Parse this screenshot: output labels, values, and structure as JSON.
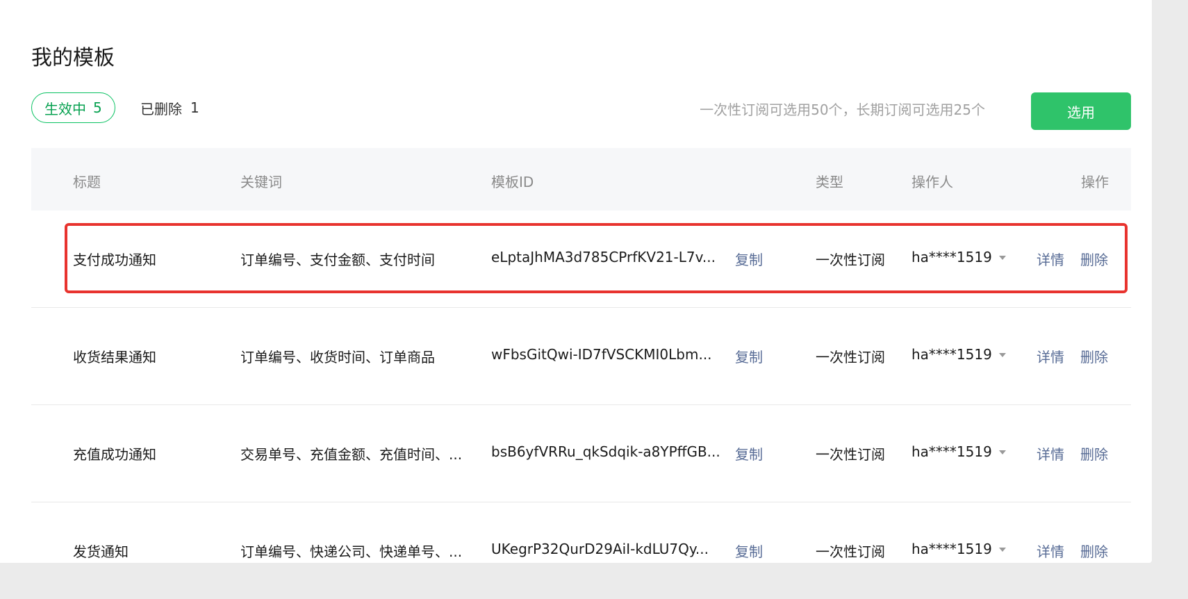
{
  "page": {
    "title": "我的模板"
  },
  "tabs": {
    "active": {
      "label": "生效中",
      "count": "5"
    },
    "deleted": {
      "label": "已删除",
      "count": "1"
    }
  },
  "quota_note": "一次性订阅可选用50个，长期订阅可选用25个",
  "select_button": "选用",
  "table": {
    "headers": {
      "title": "标题",
      "keywords": "关键词",
      "template_id": "模板ID",
      "type": "类型",
      "operator": "操作人",
      "actions": "操作"
    },
    "rows": [
      {
        "title": "支付成功通知",
        "keywords": "订单编号、支付金额、支付时间",
        "template_id": "eLptaJhMA3d785CPrfKV21-L7v...",
        "copy": "复制",
        "type": "一次性订阅",
        "operator": "ha****1519",
        "detail": "详情",
        "delete": "删除"
      },
      {
        "title": "收货结果通知",
        "keywords": "订单编号、收货时间、订单商品",
        "template_id": "wFbsGitQwi-ID7fVSCKMI0Lbm...",
        "copy": "复制",
        "type": "一次性订阅",
        "operator": "ha****1519",
        "detail": "详情",
        "delete": "删除"
      },
      {
        "title": "充值成功通知",
        "keywords": "交易单号、充值金额、充值时间、...",
        "template_id": "bsB6yfVRRu_qkSdqik-a8YPffGB...",
        "copy": "复制",
        "type": "一次性订阅",
        "operator": "ha****1519",
        "detail": "详情",
        "delete": "删除"
      },
      {
        "title": "发货通知",
        "keywords": "订单编号、快递公司、快递单号、...",
        "template_id": "UKegrP32QurD29AiI-kdLU7Qy...",
        "copy": "复制",
        "type": "一次性订阅",
        "operator": "ha****1519",
        "detail": "详情",
        "delete": "删除"
      }
    ]
  },
  "colors": {
    "accent_green": "#07c160",
    "button_green": "#2fc36a",
    "link_blue": "#576b95",
    "highlight_red": "#e8332e"
  }
}
